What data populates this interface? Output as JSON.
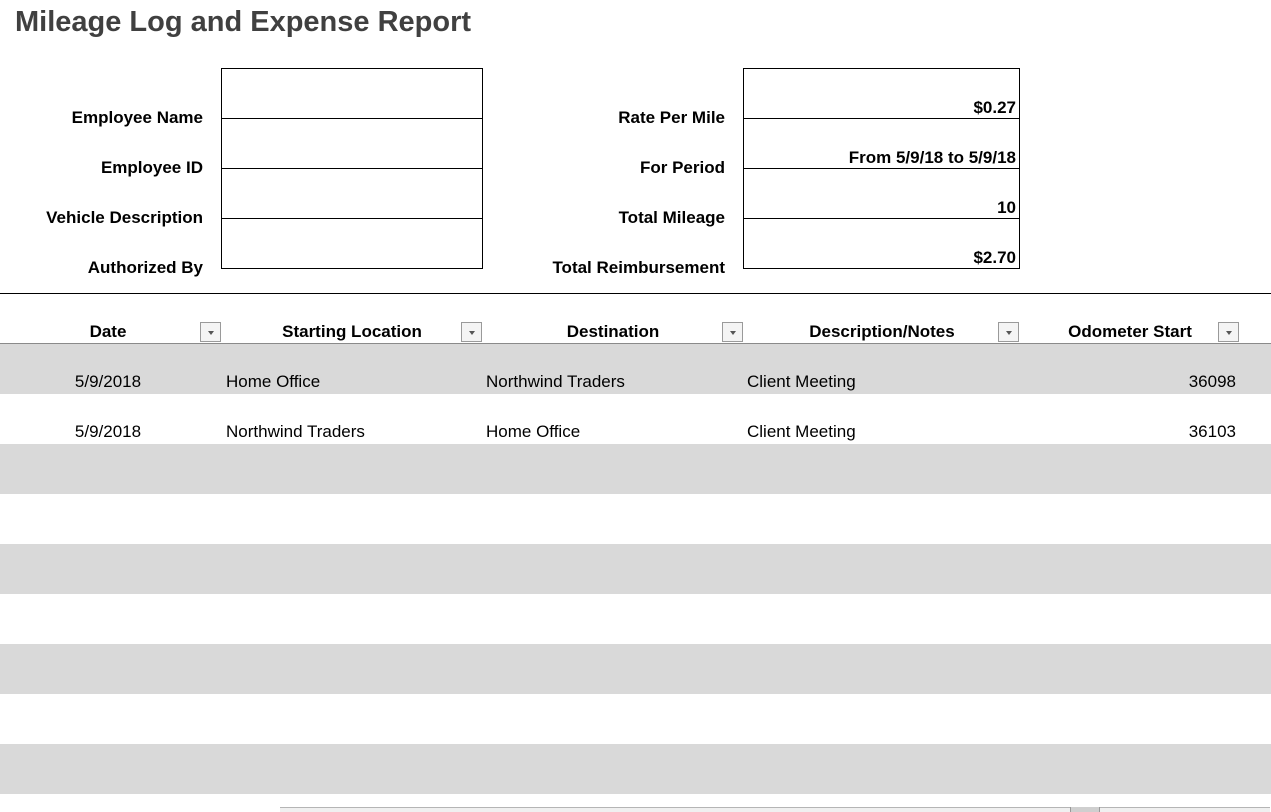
{
  "title": "Mileage Log and Expense Report",
  "employee_fields": [
    {
      "label": "Employee Name",
      "value": ""
    },
    {
      "label": "Employee ID",
      "value": ""
    },
    {
      "label": "Vehicle Description",
      "value": ""
    },
    {
      "label": "Authorized By",
      "value": ""
    }
  ],
  "summary_fields": [
    {
      "label": "Rate Per Mile",
      "value": "$0.27"
    },
    {
      "label": "For Period",
      "value": "From 5/9/18 to 5/9/18"
    },
    {
      "label": "Total Mileage",
      "value": "10"
    },
    {
      "label": "Total Reimbursement",
      "value": "$2.70"
    }
  ],
  "table": {
    "columns": [
      "Date",
      "Starting Location",
      "Destination",
      "Description/Notes",
      "Odometer Start"
    ],
    "rows": [
      {
        "date": "5/9/2018",
        "start": "Home Office",
        "destination": "Northwind Traders",
        "notes": "Client Meeting",
        "odometer_start": "36098"
      },
      {
        "date": "5/9/2018",
        "start": "Northwind Traders",
        "destination": "Home Office",
        "notes": "Client Meeting",
        "odometer_start": "36103"
      }
    ]
  },
  "colors": {
    "band": "#d9d9d9",
    "title": "#404040"
  }
}
